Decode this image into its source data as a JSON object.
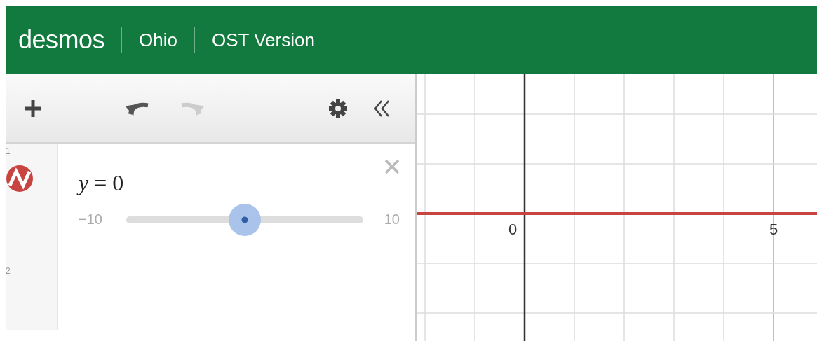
{
  "header": {
    "logo": "desmos",
    "items": [
      "Ohio",
      "OST Version"
    ]
  },
  "toolbar": {
    "undo": {
      "disabled": false
    },
    "redo": {
      "disabled": true
    }
  },
  "expressions": [
    {
      "number": "1",
      "latex": "*y* = 0",
      "color": "#c74440",
      "slider": {
        "min": "−10",
        "max": "10",
        "level": 0.5
      }
    },
    {
      "number": "2"
    }
  ],
  "graph": {
    "tick_labels": [
      "0",
      "5"
    ]
  }
}
